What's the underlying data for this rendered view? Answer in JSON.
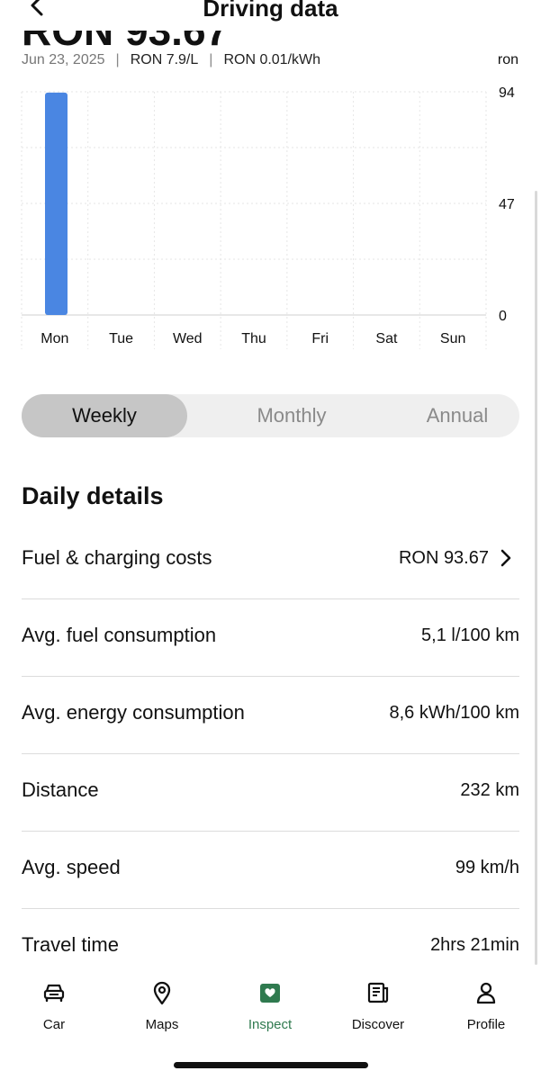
{
  "header": {
    "title": "Driving data"
  },
  "summary": {
    "amount_partial": "RON 93.67",
    "date": "Jun 23, 2025",
    "fuel_price": "RON 7.9/L",
    "energy_price": "RON 0.01/kWh",
    "unit": "ron"
  },
  "chart_data": {
    "type": "bar",
    "categories": [
      "Mon",
      "Tue",
      "Wed",
      "Thu",
      "Fri",
      "Sat",
      "Sun"
    ],
    "values": [
      93.67,
      0,
      0,
      0,
      0,
      0,
      0
    ],
    "ylim": [
      0,
      94
    ],
    "yticks": [
      "94",
      "47",
      "0"
    ],
    "color": "#4a86e2",
    "grid": true
  },
  "segments": {
    "weekly": "Weekly",
    "monthly": "Monthly",
    "annual": "Annual",
    "selected": "Weekly"
  },
  "details": {
    "title": "Daily details",
    "rows": [
      {
        "label": "Fuel & charging costs",
        "value": "RON 93.67"
      },
      {
        "label": "Avg. fuel consumption",
        "value": "5,1 l/100 km"
      },
      {
        "label": "Avg. energy consumption",
        "value": "8,6 kWh/100 km"
      },
      {
        "label": "Distance",
        "value": "232 km"
      },
      {
        "label": "Avg. speed",
        "value": "99 km/h"
      },
      {
        "label": "Travel time",
        "value": "2hrs 21min"
      }
    ]
  },
  "tabs": [
    {
      "label": "Car",
      "icon": "car-icon"
    },
    {
      "label": "Maps",
      "icon": "map-pin-icon"
    },
    {
      "label": "Inspect",
      "icon": "heart-badge-icon",
      "active": true
    },
    {
      "label": "Discover",
      "icon": "news-icon"
    },
    {
      "label": "Profile",
      "icon": "person-icon"
    }
  ],
  "colors": {
    "accent": "#2f7a4f",
    "bar": "#4a86e2"
  }
}
